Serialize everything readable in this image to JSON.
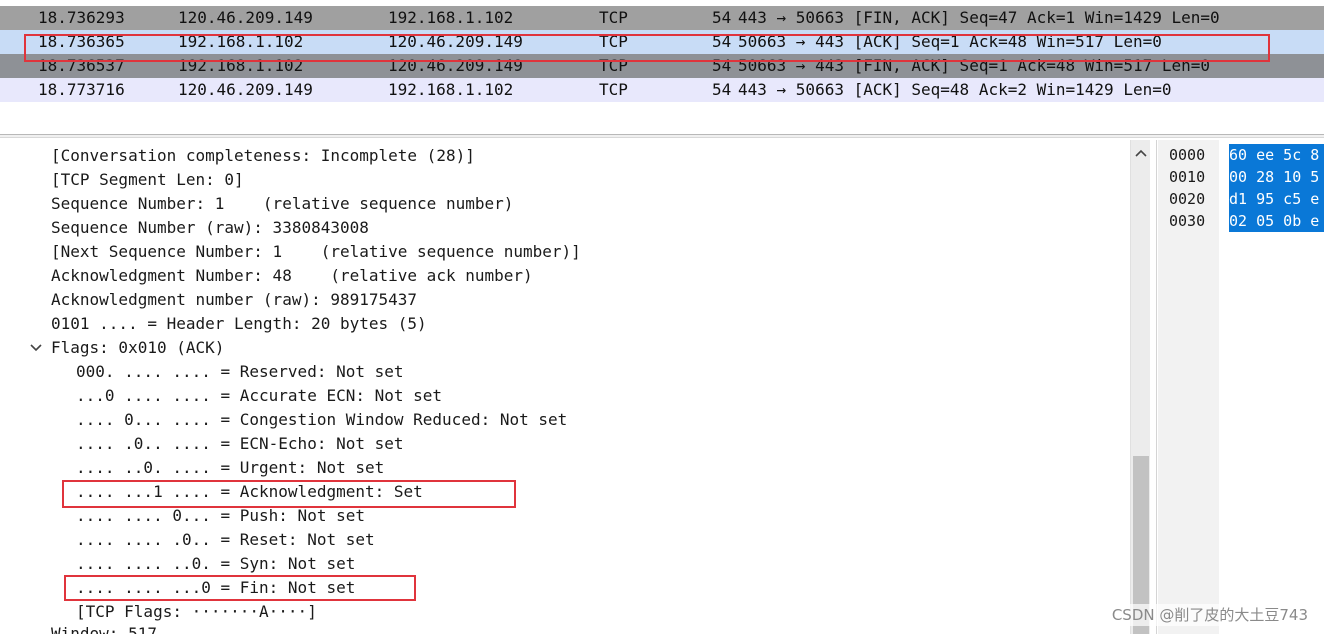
{
  "packet_list": {
    "rows": [
      {
        "time": "18.736293",
        "src": "120.46.209.149",
        "dst": "192.168.1.102",
        "proto": "TCP",
        "len": "54",
        "info": "443 → 50663 [FIN, ACK] Seq=47 Ack=1 Win=1429 Len=0"
      },
      {
        "time": "18.736365",
        "src": "192.168.1.102",
        "dst": "120.46.209.149",
        "proto": "TCP",
        "len": "54",
        "info": "50663 → 443 [ACK] Seq=1 Ack=48 Win=517 Len=0"
      },
      {
        "time": "18.736537",
        "src": "192.168.1.102",
        "dst": "120.46.209.149",
        "proto": "TCP",
        "len": "54",
        "info": "50663 → 443 [FIN, ACK] Seq=1 Ack=48 Win=517 Len=0"
      },
      {
        "time": "18.773716",
        "src": "120.46.209.149",
        "dst": "192.168.1.102",
        "proto": "TCP",
        "len": "54",
        "info": "443 → 50663 [ACK] Seq=48 Ack=2 Win=1429 Len=0"
      }
    ]
  },
  "details": {
    "lines": [
      "[Conversation completeness: Incomplete (28)]",
      "[TCP Segment Len: 0]",
      "Sequence Number: 1    (relative sequence number)",
      "Sequence Number (raw): 3380843008",
      "[Next Sequence Number: 1    (relative sequence number)]",
      "Acknowledgment Number: 48    (relative ack number)",
      "Acknowledgment number (raw): 989175437",
      "0101 .... = Header Length: 20 bytes (5)"
    ],
    "flags_header": "Flags: 0x010 (ACK)",
    "flags": [
      "000. .... .... = Reserved: Not set",
      "...0 .... .... = Accurate ECN: Not set",
      ".... 0... .... = Congestion Window Reduced: Not set",
      ".... .0.. .... = ECN-Echo: Not set",
      ".... ..0. .... = Urgent: Not set",
      ".... ...1 .... = Acknowledgment: Set",
      ".... .... 0... = Push: Not set",
      ".... .... .0.. = Reset: Not set",
      ".... .... ..0. = Syn: Not set",
      ".... .... ...0 = Fin: Not set",
      "[TCP Flags: ·······A····]"
    ],
    "trailing": "Window: 517"
  },
  "bytes": {
    "offsets": [
      "0000",
      "0010",
      "0020",
      "0030"
    ],
    "hex": [
      "60 ee 5c 8",
      "00 28 10 5",
      "d1 95 c5 e",
      "02 05 0b e"
    ]
  },
  "watermark": "CSDN @削了皮的大土豆743",
  "colors": {
    "highlight": "#e0343c",
    "selection": "#0a78d7"
  }
}
